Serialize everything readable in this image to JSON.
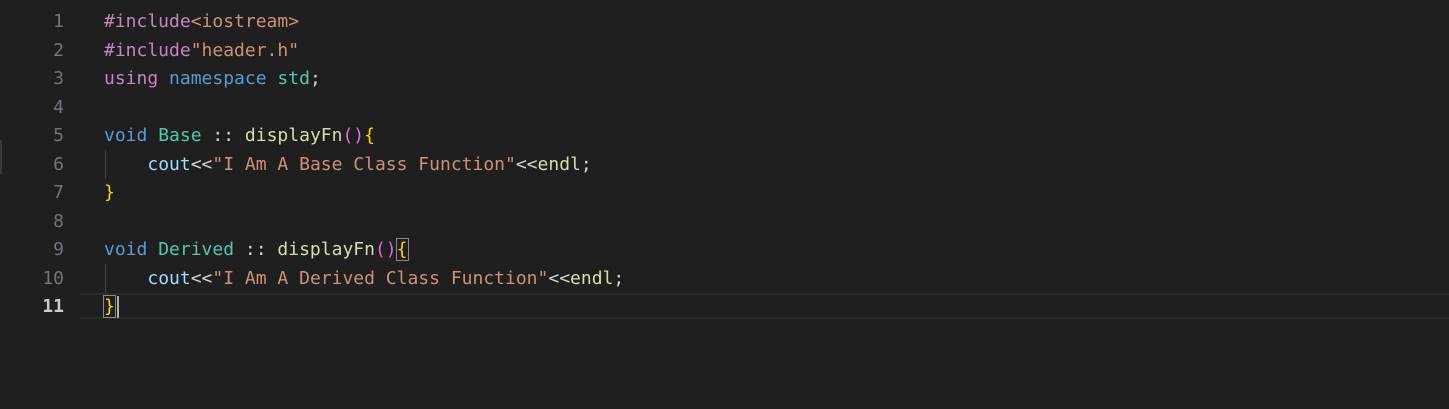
{
  "editor": {
    "active_line": 11,
    "line_numbers": [
      "1",
      "2",
      "3",
      "4",
      "5",
      "6",
      "7",
      "8",
      "9",
      "10",
      "11"
    ],
    "lines": [
      [
        {
          "t": "#include",
          "c": "pre"
        },
        {
          "t": "<iostream>",
          "c": "inc"
        }
      ],
      [
        {
          "t": "#include",
          "c": "pre"
        },
        {
          "t": "\"header.h\"",
          "c": "inc"
        }
      ],
      [
        {
          "t": "using",
          "c": "pre"
        },
        {
          "t": " ",
          "c": "op"
        },
        {
          "t": "namespace",
          "c": "kw"
        },
        {
          "t": " ",
          "c": "op"
        },
        {
          "t": "std",
          "c": "ns"
        },
        {
          "t": ";",
          "c": "op"
        }
      ],
      [],
      [
        {
          "t": "void",
          "c": "kw"
        },
        {
          "t": " ",
          "c": "op"
        },
        {
          "t": "Base",
          "c": "ns"
        },
        {
          "t": " :: ",
          "c": "op"
        },
        {
          "t": "displayFn",
          "c": "fn"
        },
        {
          "t": "()",
          "c": "br2"
        },
        {
          "t": "{",
          "c": "br"
        }
      ],
      [
        {
          "t": "    ",
          "c": "op"
        },
        {
          "t": "cout",
          "c": "var"
        },
        {
          "t": "<<",
          "c": "op"
        },
        {
          "t": "\"I Am A Base Class Function\"",
          "c": "str"
        },
        {
          "t": "<<",
          "c": "op"
        },
        {
          "t": "endl",
          "c": "fn"
        },
        {
          "t": ";",
          "c": "op"
        }
      ],
      [
        {
          "t": "}",
          "c": "br"
        }
      ],
      [],
      [
        {
          "t": "void",
          "c": "kw"
        },
        {
          "t": " ",
          "c": "op"
        },
        {
          "t": "Derived",
          "c": "ns"
        },
        {
          "t": " :: ",
          "c": "op"
        },
        {
          "t": "displayFn",
          "c": "fn"
        },
        {
          "t": "()",
          "c": "br2"
        },
        {
          "t": "{",
          "c": "br",
          "m": true
        }
      ],
      [
        {
          "t": "    ",
          "c": "op"
        },
        {
          "t": "cout",
          "c": "var"
        },
        {
          "t": "<<",
          "c": "op"
        },
        {
          "t": "\"I Am A Derived Class Function\"",
          "c": "str"
        },
        {
          "t": "<<",
          "c": "op"
        },
        {
          "t": "endl",
          "c": "fn"
        },
        {
          "t": ";",
          "c": "op"
        }
      ],
      [
        {
          "t": "}",
          "c": "br",
          "m": true
        }
      ]
    ],
    "colors": {
      "background": "#1f1f1f",
      "line_number": "#6e7681",
      "active_line_number": "#cccccc",
      "keyword": "#569cd6",
      "preprocessor": "#c586c0",
      "string": "#ce9178",
      "type": "#4ec9b0",
      "function": "#dcdcaa",
      "variable": "#9cdcfe",
      "bracket": "#ffd700"
    }
  }
}
